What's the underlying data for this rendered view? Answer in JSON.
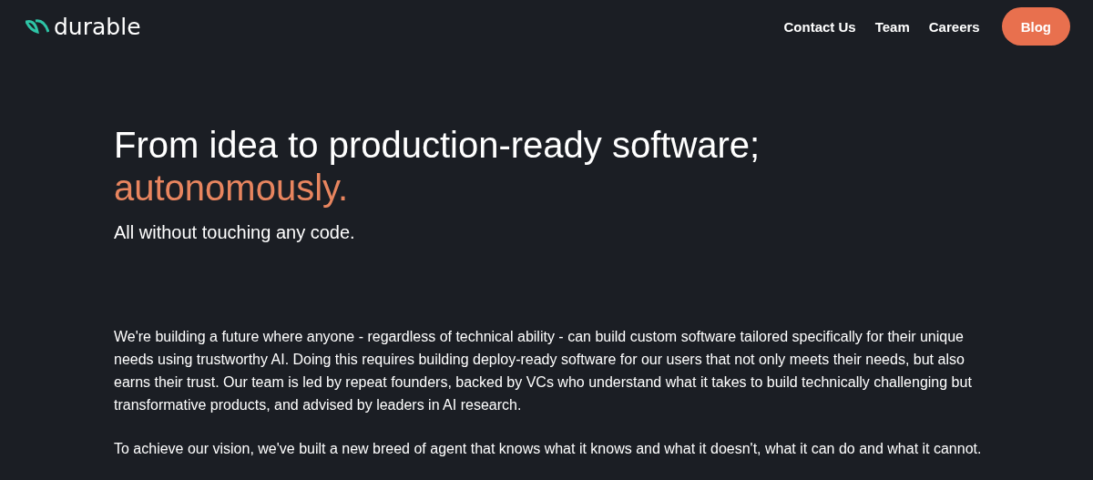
{
  "logo": {
    "text": "durable"
  },
  "nav": [
    {
      "label": "Contact Us",
      "kind": "link"
    },
    {
      "label": "Team",
      "kind": "link"
    },
    {
      "label": "Careers",
      "kind": "link"
    },
    {
      "label": "Blog",
      "kind": "button"
    }
  ],
  "hero": {
    "headline": "From idea to production-ready software;",
    "accent": "autonomously.",
    "subtitle": "All without touching any code."
  },
  "paragraphs": [
    "We're building a future where anyone - regardless of technical ability - can build custom software tailored specifically for their unique needs using trustworthy AI. Doing this requires building deploy-ready software for our users that not only meets their needs, but also earns their trust. Our team is led by repeat founders, backed by VCs who understand what it takes to build technically challenging but transformative products, and advised by leaders in AI research.",
    "To achieve our vision, we've built a new breed of agent that knows what it knows and what it doesn't, what it can do and what it cannot."
  ]
}
